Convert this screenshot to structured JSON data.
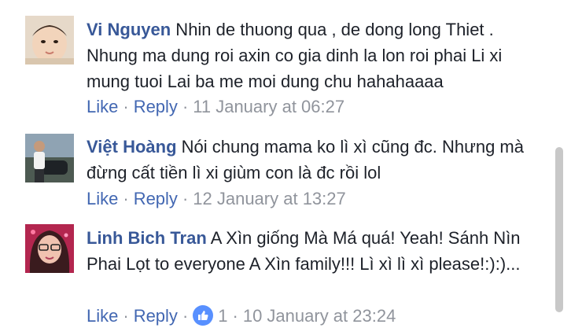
{
  "comments": [
    {
      "author": "Vi Nguyen",
      "text": " Nhin de thuong qua , de dong long Thiet . Nhung ma dung roi axin co gia dinh la lon roi phai Li xi mung tuoi Lai ba me moi dung chu hahahaaaa",
      "like_label": "Like",
      "reply_label": "Reply",
      "timestamp": "11 January at 06:27",
      "reactions": null
    },
    {
      "author": "Việt Hoàng",
      "text": " Nói chung mama ko lì xì cũng đc. Nhưng mà đừng cất tiền lì xi giùm con là đc rồi lol",
      "like_label": "Like",
      "reply_label": "Reply",
      "timestamp": "12 January at 13:27",
      "reactions": null
    },
    {
      "author": "Linh Bich Tran",
      "text": " A Xìn giống Mà Má quá! Yeah! Sánh Nìn Phai Lọt to everyone A Xìn family!!! Lì xì lì xì please!:):)...",
      "like_label": "Like",
      "reply_label": "Reply",
      "timestamp": "10 January at 23:24",
      "reactions": "1"
    }
  ],
  "separator": "·",
  "colors": {
    "author": "#385898",
    "action_link": "#4267b2",
    "meta": "#90949c",
    "like_badge": "#5890ff"
  },
  "icons": {
    "like_reaction": "thumbs-up-icon"
  }
}
